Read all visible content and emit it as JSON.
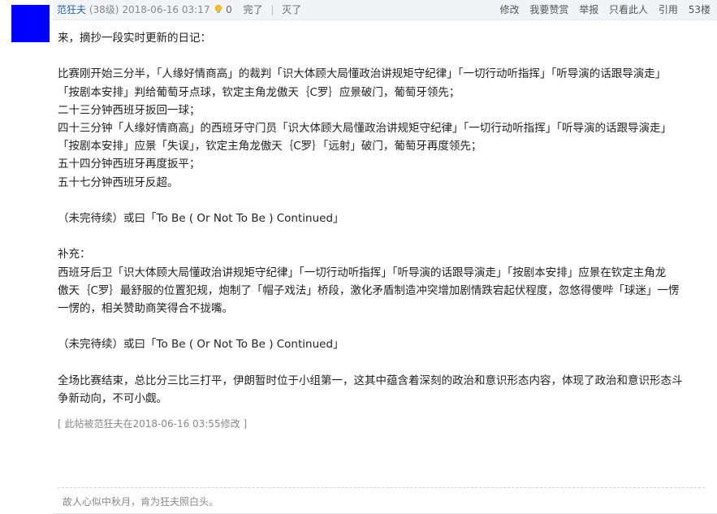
{
  "post": {
    "author": "范狂夫",
    "age": "(38级)",
    "datetime": "2018-06-16 03:17",
    "likes": "0",
    "react_done": "完了",
    "react_extinct": "灭了"
  },
  "actions": {
    "edit": "修改",
    "reward": "我要赞赏",
    "report": "举报",
    "only_this": "只看此人",
    "quote": "引用",
    "word_count": "53楼"
  },
  "content": {
    "lines": [
      "来，摘抄一段实时更新的日记：",
      "",
      "比赛刚开始三分半，「人缘好情商高」的裁判「识大体顾大局懂政治讲规矩守纪律」「一切行动听指挥」「听导演的话跟导演走」",
      "「按剧本安排」判给葡萄牙点球，钦定主角龙傲天｛C罗｝应景破门，葡萄牙领先；",
      "二十三分钟西班牙扳回一球；",
      "四十三分钟「人缘好情商高」的西班牙守门员「识大体顾大局懂政治讲规矩守纪律」「一切行动听指挥」「听导演的话跟导演走」",
      "「按剧本安排」应景「失误」，钦定主角龙傲天｛C罗｝「远射」破门，葡萄牙再度领先；",
      "五十四分钟西班牙再度扳平；",
      "五十七分钟西班牙反超。",
      "",
      "（未完待续）或曰「To Be ( Or Not To Be ) Continued」",
      "",
      "补充：",
      "西班牙后卫「识大体顾大局懂政治讲规矩守纪律」「一切行动听指挥」「听导演的话跟导演走」「按剧本安排」应景在钦定主角龙",
      "傲天｛C罗｝最舒服的位置犯规，炮制了「帽子戏法」桥段，激化矛盾制造冲突增加剧情跌宕起伏程度，忽悠得傻哔「球迷」一愣",
      "一愣的，相关赞助商笑得合不拢嘴。",
      "",
      "（未完待续）或曰「To Be ( Or Not To Be ) Continued」",
      "",
      "全场比赛结束，总比分三比三打平，伊朗暂时位于小组第一，这其中蕴含着深刻的政治和意识形态内容，体现了政治和意识形态斗",
      "争新动向，不可小觑。"
    ]
  },
  "edit_note": "[ 此帖被范狂夫在2018-06-16 03:55修改 ]",
  "signature": "故人心似中秋月，肯为狂夫照白头。",
  "colors": {
    "avatar": "#0000ff",
    "author_link": "#2a64a6",
    "header_bg": "#f1f3f6"
  },
  "icons": {
    "like": "lightbulb-icon"
  }
}
